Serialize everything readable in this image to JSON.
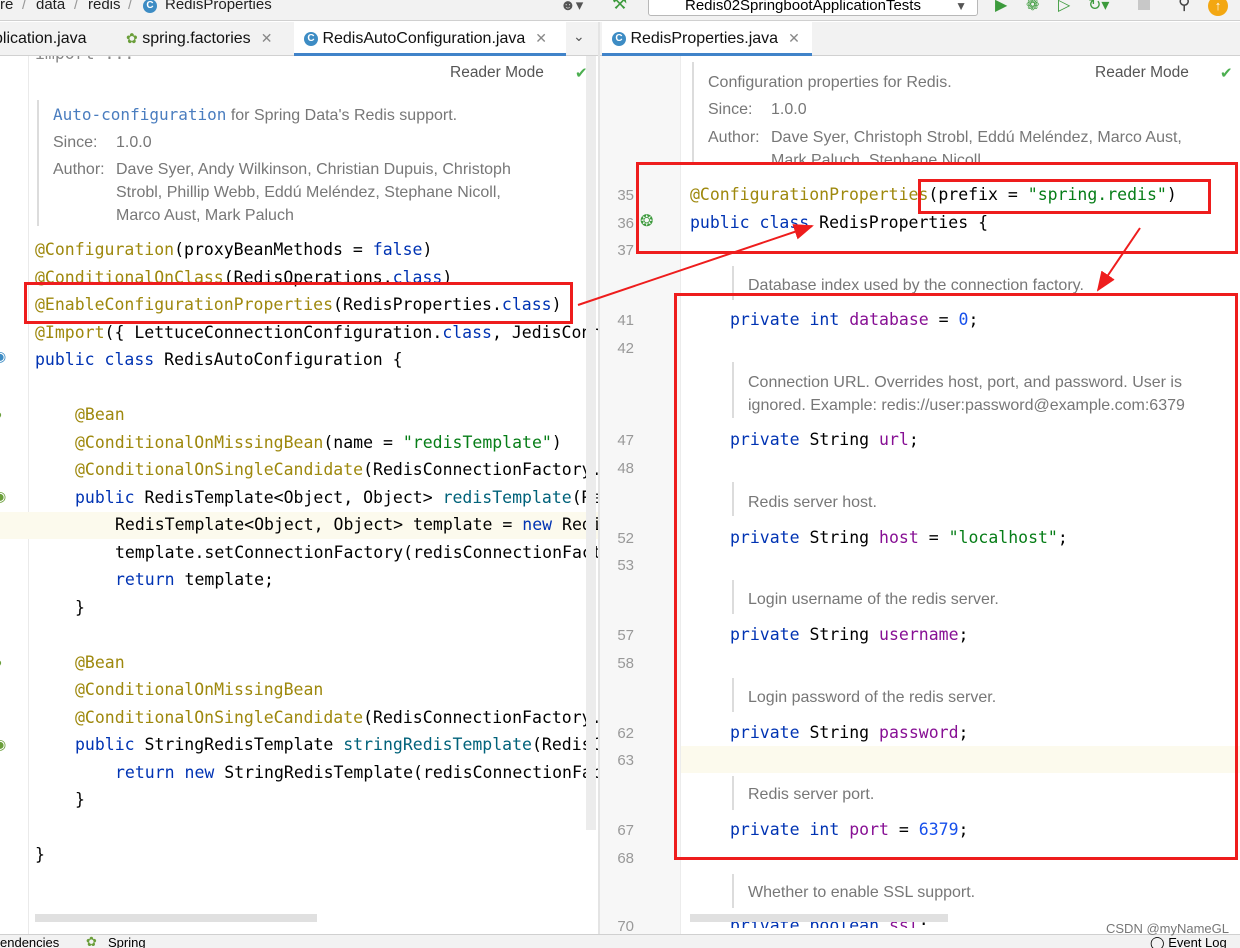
{
  "breadcrumb": {
    "items": [
      "re",
      "data",
      "redis",
      "RedisProperties"
    ],
    "run_config": "Redis02SpringbootApplicationTests"
  },
  "left_tabs": [
    {
      "label": "plication.java",
      "closable": false
    },
    {
      "label": "spring.factories",
      "closable": true
    },
    {
      "label": "RedisAutoConfiguration.java",
      "closable": true,
      "active": true
    }
  ],
  "right_tabs": [
    {
      "label": "RedisProperties.java",
      "closable": true,
      "active": true
    }
  ],
  "left": {
    "reader_mode": "Reader Mode",
    "import_line": "import ...",
    "doc": {
      "summary_code": "Auto-configuration",
      "summary_rest": " for Spring Data's Redis support.",
      "since_label": "Since:",
      "since_value": "1.0.0",
      "author_label": "Author:",
      "author_line1": "Dave Syer, Andy Wilkinson, Christian Dupuis, Christoph",
      "author_line2": "Strobl, Phillip Webb, Eddú Meléndez, Stephane Nicoll,",
      "author_line3": "Marco Aust, Mark Paluch"
    },
    "code": {
      "l1_ann": "@Configuration",
      "l1_a": "(proxyBeanMethods = ",
      "l1_kw": "false",
      "l1_b": ")",
      "l2_ann": "@ConditionalOnClass",
      "l2_a": "(RedisOperations.",
      "l2_kw": "class",
      "l2_b": ")",
      "l3_ann": "@EnableConfigurationProperties",
      "l3_a": "(RedisProperties.",
      "l3_kw": "class",
      "l3_b": ")",
      "l4_ann": "@Import",
      "l4_a": "({ LettuceConnectionConfiguration.",
      "l4_kw": "class",
      "l4_b": ", JedisConn",
      "l5_kw": "public class ",
      "l5_a": "RedisAutoConfiguration {",
      "l6": "@Bean",
      "l7_ann": "@ConditionalOnMissingBean",
      "l7_a": "(name = ",
      "l7_str": "\"redisTemplate\"",
      "l7_b": ")",
      "l8_ann": "@ConditionalOnSingleCandidate",
      "l8_a": "(RedisConnectionFactory.",
      "l9_kw": "public ",
      "l9_a": "RedisTemplate<Object, Object> ",
      "l9_m": "redisTemplate",
      "l9_b": "(Re",
      "l10_a": "RedisTemplate<Object, Object> template = ",
      "l10_kw": "new ",
      "l10_b": "Redis",
      "l11": "template.setConnectionFactory(redisConnectionFact",
      "l12_kw": "return ",
      "l12_a": "template;",
      "l13": "}",
      "l14": "@Bean",
      "l15": "@ConditionalOnMissingBean",
      "l16_ann": "@ConditionalOnSingleCandidate",
      "l16_a": "(RedisConnectionFactory.",
      "l17_kw": "public ",
      "l17_a": "StringRedisTemplate ",
      "l17_m": "stringRedisTemplate",
      "l17_b": "(RedisC",
      "l18_kw": "return new ",
      "l18_a": "StringRedisTemplate(redisConnectionFac",
      "l19": "}",
      "l20": "}"
    }
  },
  "right": {
    "reader_mode": "Reader Mode",
    "doc": {
      "summary": "Configuration properties for Redis.",
      "since_label": "Since:",
      "since_value": "1.0.0",
      "author_label": "Author:",
      "author_line1": "Dave Syer, Christoph Strobl, Eddú Meléndez, Marco Aust,",
      "author_line2": "Mark Paluch, Stephane Nicoll"
    },
    "line_numbers": [
      "35",
      "36",
      "37",
      "41",
      "42",
      "47",
      "48",
      "52",
      "53",
      "57",
      "58",
      "62",
      "63",
      "67",
      "68",
      "70"
    ],
    "code": {
      "ann_name": "@ConfigurationProperties",
      "ann_a": "(prefix = ",
      "ann_str": "\"spring.redis\"",
      "ann_b": ")",
      "class_kw": "public class ",
      "class_name": "RedisProperties {",
      "doc_database": "Database index used by the connection factory.",
      "database_kw": "private int ",
      "database_fld": "database",
      "database_eq": " = ",
      "database_val": "0",
      "semi": ";",
      "doc_url_1": "Connection URL. Overrides host, port, and password. User is",
      "doc_url_2": "ignored. Example: redis://user:password@example.com:6379",
      "url_kw": "private ",
      "url_type": "String ",
      "url_fld": "url",
      "doc_host": "Redis server host.",
      "host_kw": "private ",
      "host_type": "String ",
      "host_fld": "host",
      "host_eq": " = ",
      "host_val": "\"localhost\"",
      "doc_username": "Login username of the redis server.",
      "username_kw": "private ",
      "username_type": "String ",
      "username_fld": "username",
      "doc_password": "Login password of the redis server.",
      "password_kw": "private ",
      "password_type": "String ",
      "password_fld": "password",
      "doc_port": "Redis server port.",
      "port_kw": "private int ",
      "port_fld": "port",
      "port_eq": " = ",
      "port_val": "6379",
      "doc_ssl": "Whether to enable SSL support.",
      "ssl_kw": "private boolean ",
      "ssl_fld": "ssl"
    }
  },
  "bottom": {
    "left_tab": "endencies",
    "spring_tab": "Spring",
    "event_log": "Event Log"
  },
  "watermark": "CSDN @myNameGL",
  "colors": {
    "keyword": "#0033b3",
    "annotation": "#9e880d",
    "string": "#067d17",
    "field": "#871094",
    "number": "#1750eb",
    "highlight_box": "#ee1d1d"
  }
}
